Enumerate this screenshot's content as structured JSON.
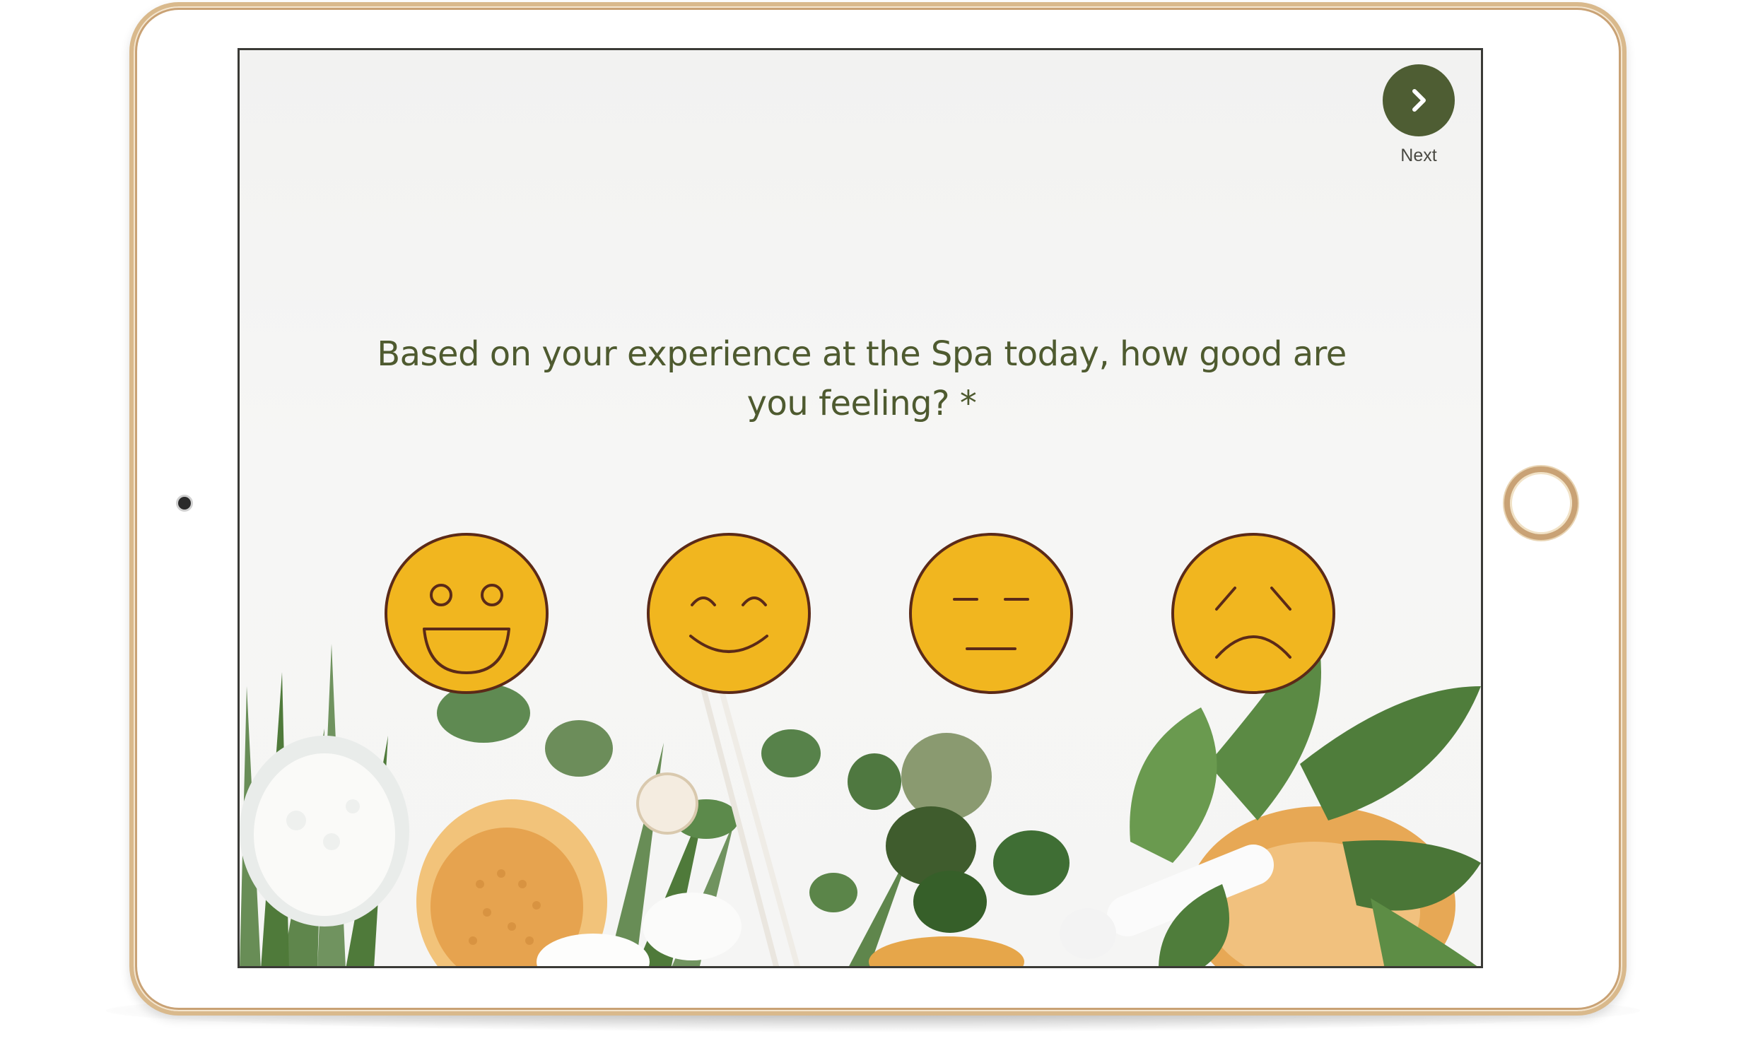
{
  "survey": {
    "question": "Based on your experience at the Spa today, how good are you feeling? *",
    "next_label": "Next",
    "next_icon": "chevron-right-icon",
    "options": [
      {
        "name": "very-happy-face-icon",
        "icon": "grinning-face"
      },
      {
        "name": "happy-face-icon",
        "icon": "smiling-face"
      },
      {
        "name": "neutral-face-icon",
        "icon": "neutral-face"
      },
      {
        "name": "sad-face-icon",
        "icon": "sad-face"
      }
    ]
  },
  "colors": {
    "accent": "#4e5d33",
    "question_text": "#4e5a2f",
    "face_fill": "#f1b61f",
    "face_stroke": "#5b2a18",
    "device_frame": "#d9b98c"
  }
}
